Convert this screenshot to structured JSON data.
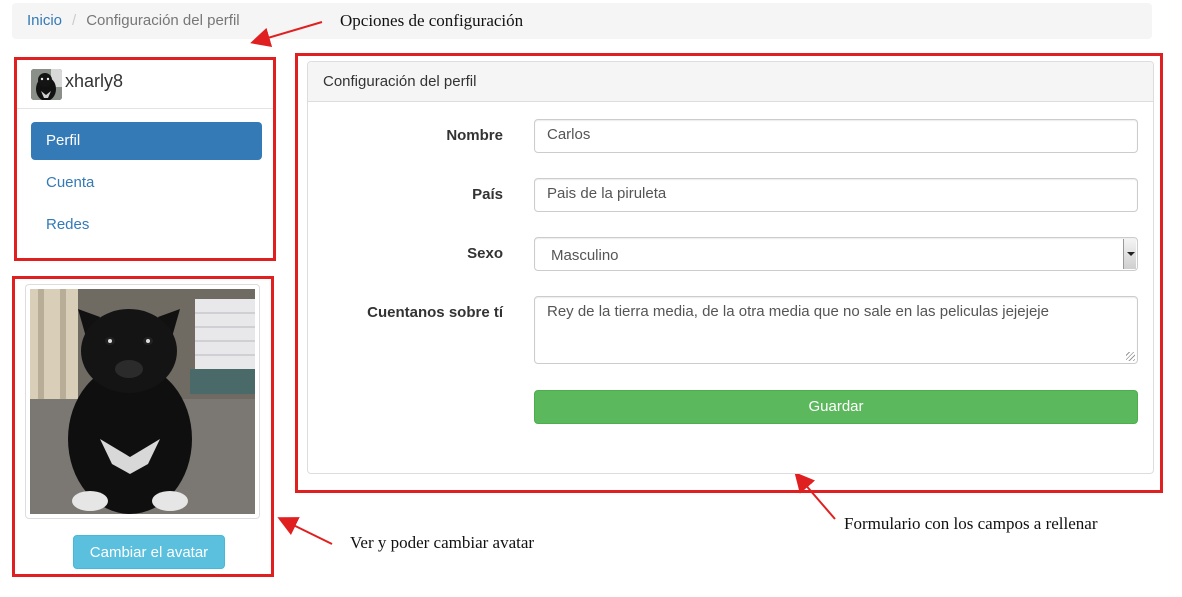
{
  "breadcrumb": {
    "home": "Inicio",
    "current": "Configuración del perfil"
  },
  "annotations": {
    "options": "Opciones de configuración",
    "avatar": "Ver y poder cambiar avatar",
    "form": "Formulario con los campos a rellenar"
  },
  "profile": {
    "username": "xharly8",
    "menu": [
      {
        "label": "Perfil",
        "active": true
      },
      {
        "label": "Cuenta",
        "active": false
      },
      {
        "label": "Redes",
        "active": false
      }
    ]
  },
  "avatar": {
    "change_button": "Cambiar el avatar"
  },
  "form": {
    "heading": "Configuración del perfil",
    "fields": {
      "name": {
        "label": "Nombre",
        "value": "Carlos"
      },
      "country": {
        "label": "País",
        "value": "Pais de la piruleta"
      },
      "sex": {
        "label": "Sexo",
        "value": "Masculino"
      },
      "about": {
        "label": "Cuentanos sobre tí",
        "value": "Rey de la tierra media, de la otra media que no sale en las peliculas jejejeje"
      }
    },
    "save_button": "Guardar"
  },
  "colors": {
    "primary": "#337ab7",
    "success": "#5cb85c",
    "info": "#5bc0de",
    "annotation": "#e02020"
  }
}
